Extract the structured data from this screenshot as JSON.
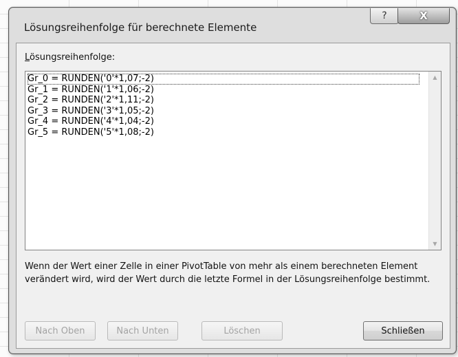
{
  "dialog": {
    "title": "Lösungsreihenfolge für berechnete Elemente",
    "help_label": "?",
    "close_label": "X"
  },
  "list": {
    "label_underlined": "L",
    "label_rest": "ösungsreihenfolge:",
    "items": [
      "Gr_0 = RUNDEN('0'*1,07;-2)",
      "Gr_1 = RUNDEN('1'*1,06;-2)",
      "Gr_2 = RUNDEN('2'*1,11;-2)",
      "Gr_3 = RUNDEN('3'*1,05;-2)",
      "Gr_4 = RUNDEN('4'*1,04;-2)",
      "Gr_5 = RUNDEN('5'*1,08;-2)"
    ]
  },
  "info_text": "Wenn der Wert einer Zelle in einer PivotTable von mehr als einem berechneten Element verändert wird, wird der Wert durch die letzte Formel in der Lösungsreihenfolge bestimmt.",
  "buttons": {
    "up": "Nach Oben",
    "down": "Nach Unten",
    "delete": "Löschen",
    "close": "Schließen"
  },
  "icons": {
    "scroll_up": "scroll-up-arrow-icon",
    "scroll_down": "scroll-down-arrow-icon"
  }
}
